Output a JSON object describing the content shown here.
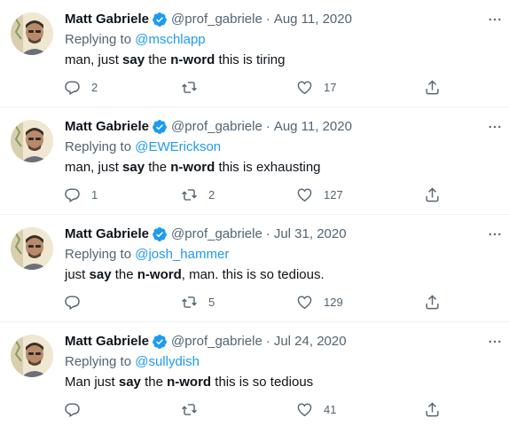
{
  "tweets": [
    {
      "name": "Matt Gabriele",
      "handle": "@prof_gabriele",
      "dot": "·",
      "date": "Aug 11, 2020",
      "replying_prefix": "Replying to",
      "replying_to": "@mschlapp",
      "text_1": "man, just",
      "text_2": "say",
      "text_3": "the",
      "text_4": "n-word",
      "text_5": "this is tiring",
      "replies": "2",
      "retweets": "",
      "likes": "17"
    },
    {
      "name": "Matt Gabriele",
      "handle": "@prof_gabriele",
      "dot": "·",
      "date": "Aug 11, 2020",
      "replying_prefix": "Replying to",
      "replying_to": "@EWErickson",
      "text_1": "man, just",
      "text_2": "say",
      "text_3": "the",
      "text_4": "n-word",
      "text_5": "this is exhausting",
      "replies": "1",
      "retweets": "2",
      "likes": "127"
    },
    {
      "name": "Matt Gabriele",
      "handle": "@prof_gabriele",
      "dot": "·",
      "date": "Jul 31, 2020",
      "replying_prefix": "Replying to",
      "replying_to": "@josh_hammer",
      "text_1": "just",
      "text_2": "say",
      "text_3": "the",
      "text_4": "n-word",
      "text_5": ", man. this is so tedious.",
      "replies": "",
      "retweets": "5",
      "likes": "129"
    },
    {
      "name": "Matt Gabriele",
      "handle": "@prof_gabriele",
      "dot": "·",
      "date": "Jul 24, 2020",
      "replying_prefix": "Replying to",
      "replying_to": "@sullydish",
      "text_1": "Man just",
      "text_2": "say",
      "text_3": "the",
      "text_4": "n-word",
      "text_5": "this is so tedious",
      "replies": "",
      "retweets": "",
      "likes": "41"
    }
  ],
  "icons": {
    "verified": "verified-badge-icon",
    "more": "more-options-icon",
    "reply": "reply-icon",
    "retweet": "retweet-icon",
    "like": "heart-icon",
    "share": "share-icon"
  },
  "colors": {
    "link": "#1d9bf0",
    "muted": "#536471",
    "text": "#0f1419",
    "divider": "#eff3f4"
  }
}
